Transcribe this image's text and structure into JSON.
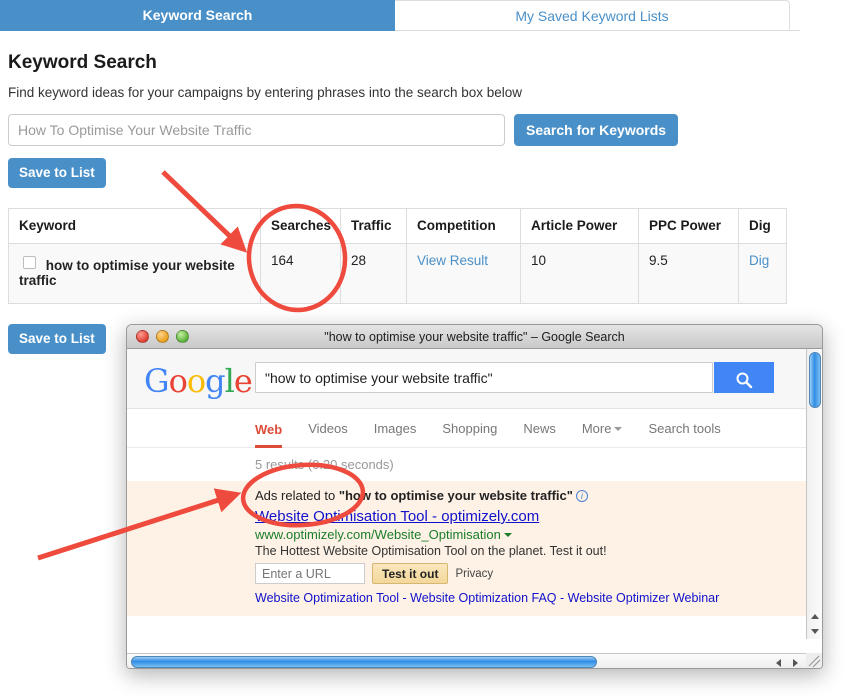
{
  "tabs": [
    {
      "label": "Keyword Search",
      "active": true
    },
    {
      "label": "My Saved Keyword Lists",
      "active": false
    }
  ],
  "page": {
    "title": "Keyword Search",
    "subtitle": "Find keyword ideas for your campaigns by entering phrases into the search box below"
  },
  "search": {
    "placeholder": "How To Optimise Your Website Traffic",
    "value": "",
    "button_label": "Search for Keywords"
  },
  "save_button_label": "Save to List",
  "table": {
    "columns": [
      "Keyword",
      "Searches",
      "Traffic",
      "Competition",
      "Article Power",
      "PPC Power",
      "Dig"
    ],
    "rows": [
      {
        "keyword": "how to optimise your website traffic",
        "searches": "164",
        "traffic": "28",
        "competition": "View Result",
        "article_power": "10",
        "ppc_power": "9.5",
        "dig": "Dig",
        "checked": false
      }
    ]
  },
  "browser": {
    "title": "\"how to optimise your website traffic\" – Google Search",
    "traffic_lights": [
      "close-red",
      "minimize-amber",
      "zoom-green"
    ],
    "google": {
      "logo": "Google",
      "query": "\"how to optimise your website traffic\"",
      "search_icon": "magnifier-icon",
      "nav": [
        {
          "label": "Web",
          "selected": true
        },
        {
          "label": "Videos",
          "selected": false
        },
        {
          "label": "Images",
          "selected": false
        },
        {
          "label": "Shopping",
          "selected": false
        },
        {
          "label": "News",
          "selected": false
        },
        {
          "label": "More",
          "selected": false,
          "caret": true
        },
        {
          "label": "Search tools",
          "selected": false
        }
      ],
      "result_stats": "5 results (0.20 seconds)",
      "ads": {
        "header_prefix": "Ads related to ",
        "header_query": "\"how to optimise your website traffic\"",
        "info_icon": "info-icon",
        "title": "Website Optimisation Tool - optimizely.com",
        "url": "www.optimizely.com/Website_Optimisation",
        "description": "The Hottest Website Optimisation Tool on the planet. Test it out!",
        "input_placeholder": "Enter a URL",
        "cta_label": "Test it out",
        "privacy_label": "Privacy",
        "sitelinks": "Website Optimization Tool - Website Optimization FAQ - Website Optimizer Webinar"
      }
    }
  },
  "annotations": {
    "color": "#ee4a3d",
    "items": [
      {
        "type": "arrow",
        "target": "searches-column-header"
      },
      {
        "type": "ellipse",
        "target": "searches-column-values"
      },
      {
        "type": "arrow",
        "target": "google-result-stats"
      },
      {
        "type": "ellipse",
        "target": "google-result-stats"
      }
    ]
  },
  "colors": {
    "accent_blue": "#4a90c8",
    "google_blue": "#4285f4",
    "annotation_red": "#ee4a3d",
    "ads_background": "#fdf2e5"
  }
}
